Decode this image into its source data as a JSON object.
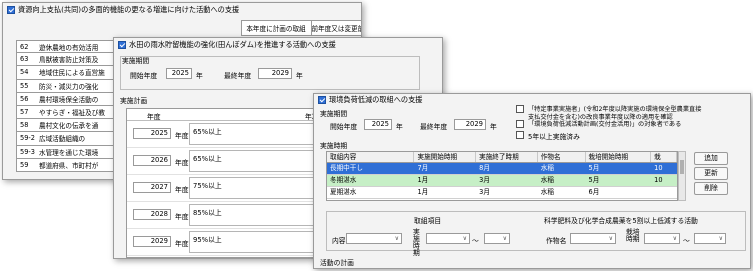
{
  "win1": {
    "title": "資源向上支払(共同)の多面的機能の更なる増進に向けた活動への支援",
    "headers": [
      "本年度に計画の取組",
      "前年度又は変更前の取組"
    ],
    "rows": [
      {
        "num": "62",
        "text": "遊休農地の有効活用"
      },
      {
        "num": "63",
        "text": "鳥獣被害防止対策及"
      },
      {
        "num": "54",
        "text": "地域住民による直営施"
      },
      {
        "num": "55",
        "text": "防災・減災力の強化"
      },
      {
        "num": "56",
        "text": "農村環境保全活動の"
      },
      {
        "num": "57",
        "text": "やすらぎ・福祉及び教"
      },
      {
        "num": "58",
        "text": "農村文化の伝承を通"
      },
      {
        "num": "59-2",
        "text": "広域活動組織の"
      },
      {
        "num": "59-3",
        "text": "水管理を通じた環境"
      },
      {
        "num": "59",
        "text": "都道府県、市町村が"
      }
    ]
  },
  "win2": {
    "title": "水田の雨水貯留機能の強化(田んぼダム)を推進する活動への支援",
    "period_group": "実施期間",
    "start_label": "開始年度",
    "start_year": "2025",
    "year_unit": "年",
    "end_label": "最終年度",
    "end_year": "2029",
    "plan_label": "実施計画",
    "col_year": "年度",
    "col_plan": "年次計",
    "rows": [
      {
        "year": "2025",
        "unit": "年度",
        "value": "65%以上"
      },
      {
        "year": "2026",
        "unit": "年度",
        "value": "65%以上"
      },
      {
        "year": "2027",
        "unit": "年度",
        "value": "75%以上"
      },
      {
        "year": "2028",
        "unit": "年度",
        "value": "85%以上"
      },
      {
        "year": "2029",
        "unit": "年度",
        "value": "95%以上"
      }
    ]
  },
  "win3": {
    "title": "環境負荷低減の取組への支援",
    "period_label": "実施期間",
    "start_label": "開始年度",
    "start_year": "2025",
    "year_unit": "年",
    "end_label": "最終年度",
    "end_year": "2029",
    "note1": "「特定事業実施者」(令和2年度以降実施の環境保全型農業直接",
    "note2": "支払交付金を含む)の改良事業年度以降の適用を確認",
    "note3": "「環境負荷低減活動計画(交付金活用)」の対象者である",
    "five_year_label": "5年以上実施済み",
    "table_label": "実施時期",
    "columns": [
      "取組内容",
      "実施開始時期",
      "実施終了時期",
      "作物名",
      "栽培開始時期",
      "栽"
    ],
    "rows": [
      {
        "c1": "長期中干し",
        "c2": "7月",
        "c3": "8月",
        "c4": "水稲",
        "c5": "5月",
        "c6": "10"
      },
      {
        "c1": "冬期湛水",
        "c2": "1月",
        "c3": "3月",
        "c4": "水稲",
        "c5": "5月",
        "c6": "10"
      },
      {
        "c1": "夏期湛水",
        "c2": "1月",
        "c3": "3月",
        "c4": "水稲",
        "c5": "6月",
        "c6": ""
      }
    ],
    "btn_add": "追加",
    "btn_update": "更新",
    "btn_delete": "削除",
    "input_group_left": "取組項目",
    "input_group_right": "科学肥料及び化学合成農薬を5割以上低減する活動",
    "content_label": "内容",
    "period_label2": "実施時期",
    "tilde": "〜",
    "crop_label": "作物名",
    "cult_label": "栽培時期",
    "activity_plan_label": "活動の計画"
  },
  "colors": {
    "accent": "#2f6fd6",
    "row_selected": "#2f6fd6",
    "row_green": "#c6efc6"
  }
}
